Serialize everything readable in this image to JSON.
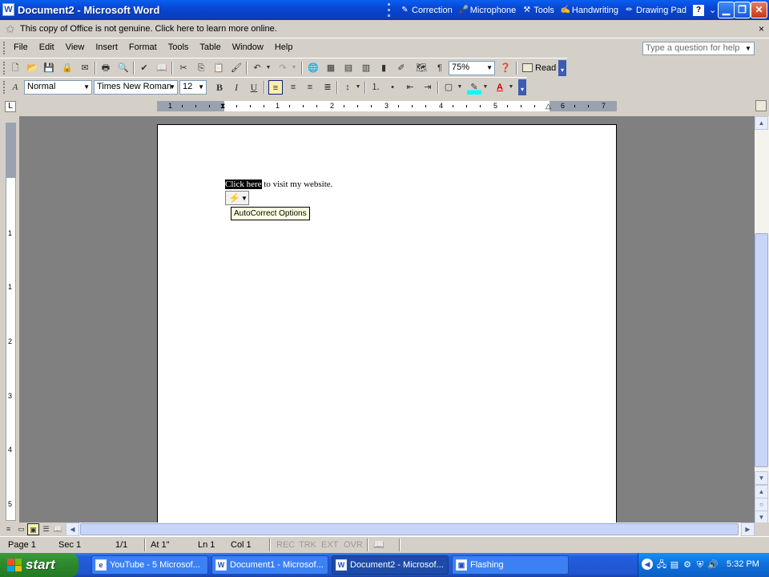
{
  "window": {
    "title": "Document2 - Microsoft Word",
    "app_icon": "word-doc-icon",
    "buttons": [
      "minimize",
      "restore",
      "close"
    ]
  },
  "language_bar": {
    "items": [
      {
        "label": "Correction",
        "icon": "correction-icon"
      },
      {
        "label": "Microphone",
        "icon": "microphone-icon"
      },
      {
        "label": "Tools",
        "icon": "tools-icon"
      },
      {
        "label": "Handwriting",
        "icon": "handwriting-icon"
      },
      {
        "label": "Drawing Pad",
        "icon": "drawing-pad-icon"
      }
    ],
    "help_label": "?"
  },
  "genuine_bar": {
    "message": "This copy of Office is not genuine.  Click here to learn more online.",
    "close": "×"
  },
  "menu": {
    "items": [
      "File",
      "Edit",
      "View",
      "Insert",
      "Format",
      "Tools",
      "Table",
      "Window",
      "Help"
    ],
    "help_placeholder": "Type a question for help"
  },
  "standard_toolbar": {
    "zoom": "75%",
    "read_label": "Read"
  },
  "formatting_toolbar": {
    "style": "Normal",
    "font": "Times New Roman",
    "size": "12",
    "bold": "B",
    "italic": "I",
    "underline": "U"
  },
  "ruler": {
    "numbers": [
      "1",
      "1",
      "2",
      "3",
      "4",
      "5",
      "6",
      "7"
    ]
  },
  "vertical_ruler": {
    "numbers": [
      "1",
      "1",
      "2",
      "3",
      "4",
      "5"
    ]
  },
  "document": {
    "selected_text": "Click here",
    "rest_text": " to visit my website.",
    "tooltip": "AutoCorrect Options"
  },
  "status_bar": {
    "page": "Page  1",
    "section": "Sec  1",
    "pages": "1/1",
    "at": "At  1\"",
    "line": "Ln  1",
    "col": "Col  1",
    "rec": "REC",
    "trk": "TRK",
    "ext": "EXT",
    "ovr": "OVR"
  },
  "taskbar": {
    "start_label": "start",
    "tasks": [
      {
        "label": "YouTube - 5 Microsof...",
        "icon": "ie-icon",
        "active": false
      },
      {
        "label": "Document1 - Microsof...",
        "icon": "word-doc-icon",
        "active": false
      },
      {
        "label": "Document2 - Microsof...",
        "icon": "word-doc-icon",
        "active": true
      },
      {
        "label": "Flashing",
        "icon": "window-icon",
        "active": false
      }
    ],
    "clock": "5:32 PM"
  }
}
